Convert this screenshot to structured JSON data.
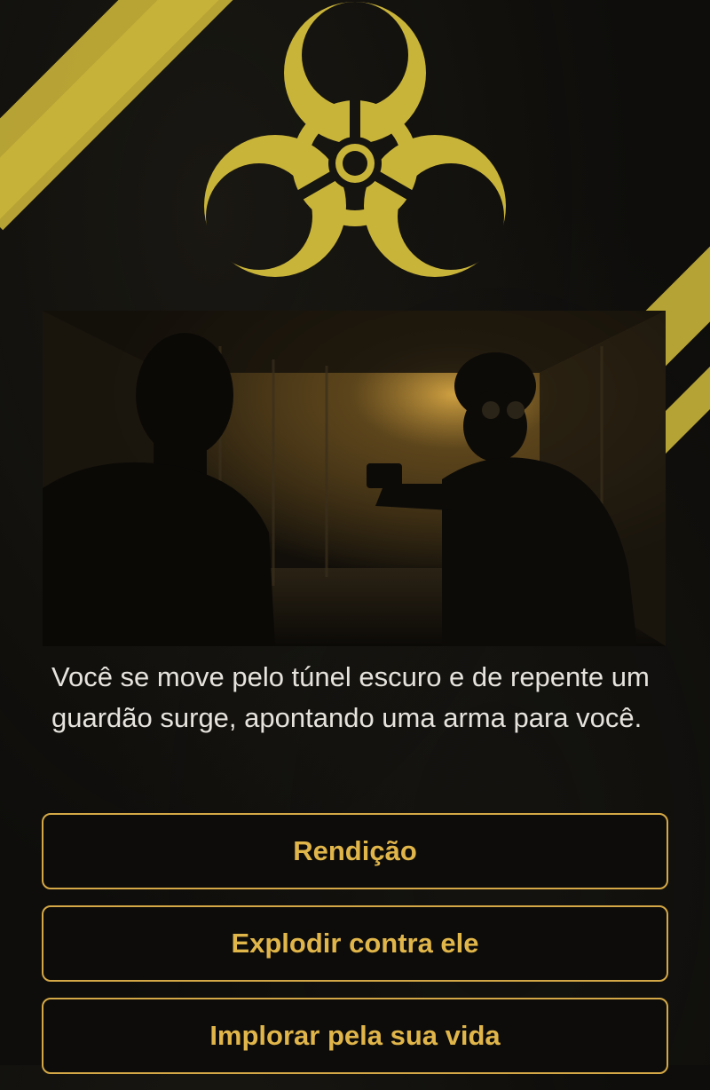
{
  "story": {
    "text": "Você se move pelo túnel escuro e de repente um guardão surge, apontando uma arma para você."
  },
  "scene": {
    "description_icon": "scene-illustration"
  },
  "emblem": {
    "icon": "biohazard-icon",
    "color": "#c9b43a"
  },
  "choices": [
    {
      "label": "Rendição"
    },
    {
      "label": "Explodir contra ele"
    },
    {
      "label": "Implorar pela sua vida"
    }
  ],
  "colors": {
    "accent": "#d4a846",
    "button_text": "#e0b54a",
    "background": "#0e0d0b",
    "stripe": "#c9b43a"
  }
}
